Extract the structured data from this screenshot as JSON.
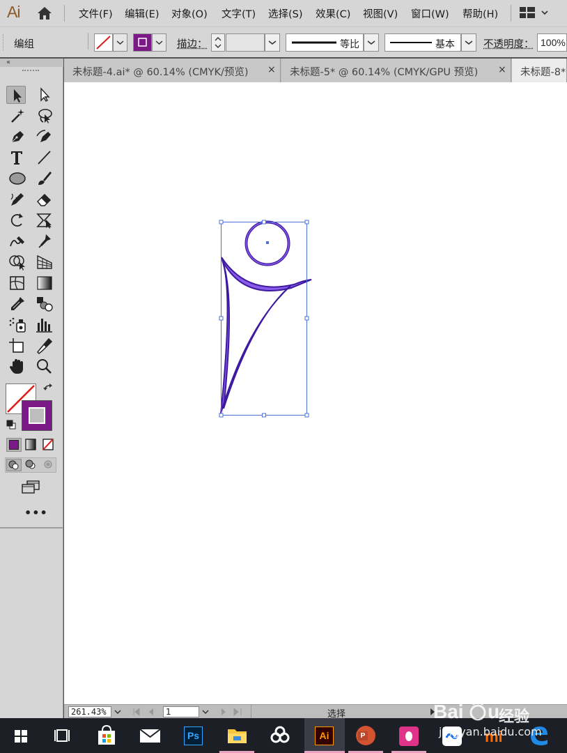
{
  "app": {
    "logo": "Ai"
  },
  "menu": [
    "文件(F)",
    "编辑(E)",
    "对象(O)",
    "文字(T)",
    "选择(S)",
    "效果(C)",
    "视图(V)",
    "窗口(W)",
    "帮助(H)"
  ],
  "control_bar": {
    "selection_type": "编组",
    "stroke_label": "描边：",
    "profile_label": "等比",
    "brush_label": "基本",
    "opacity_label": "不透明度：",
    "opacity_value": "100%"
  },
  "colors": {
    "fill_swatch": "#7b1a86",
    "shape_stroke": "#6a31c8",
    "selection": "#4a6fd8",
    "no_stroke_red": "#e01a1a"
  },
  "tabs": [
    {
      "title": "未标题-4.ai* @ 60.14% (CMYK/预览)",
      "close": "×"
    },
    {
      "title": "未标题-5* @ 60.14% (CMYK/GPU 预览)",
      "close": "×"
    },
    {
      "title": "未标题-8*",
      "close": ""
    }
  ],
  "tools": [
    "selection-tool-icon",
    "direct-selection-tool-icon",
    "magic-wand-tool-icon",
    "lasso-tool-icon",
    "pen-tool-icon",
    "curvature-tool-icon",
    "type-tool-icon",
    "line-segment-tool-icon",
    "ellipse-tool-icon",
    "paintbrush-tool-icon",
    "shaper-tool-icon",
    "eraser-tool-icon",
    "rotate-tool-icon",
    "free-transform-tool-icon",
    "warp-tool-icon",
    "puppet-warp-tool-icon",
    "shape-builder-tool-icon",
    "perspective-grid-tool-icon",
    "mesh-tool-icon",
    "gradient-tool-icon",
    "eyedropper-tool-icon",
    "blend-tool-icon",
    "symbol-sprayer-tool-icon",
    "column-graph-tool-icon",
    "artboard-tool-icon",
    "slice-tool-icon",
    "hand-tool-icon",
    "zoom-tool-icon"
  ],
  "tool_panel": {
    "more": "•••"
  },
  "status_bar": {
    "zoom": "261.43%",
    "page": "1",
    "status": "选择"
  },
  "taskbar": [
    "windows-start-icon",
    "task-view-icon",
    "store-icon",
    "mail-icon",
    "photoshop-icon",
    "file-explorer-icon",
    "baidu-netdisk-icon",
    "illustrator-icon",
    "powerpoint-icon",
    "qq-icon",
    "tencent-meeting-icon",
    "mi-icon",
    "edge-icon"
  ],
  "taskbar_labels": {
    "ps": "Ps",
    "ai": "Ai",
    "ppt": "P",
    "mi": "mi"
  },
  "watermark": {
    "text": "经验",
    "url": "jingyan.baidu.com"
  }
}
